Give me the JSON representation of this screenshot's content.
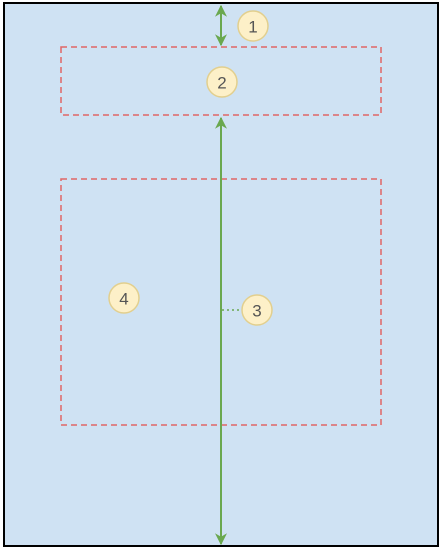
{
  "colors": {
    "background": "#cfe2f3",
    "border": "#000000",
    "dashed_box": "#e06666",
    "arrow": "#6aa84f",
    "badge_fill": "#fdf0c8",
    "badge_stroke": "#e2cf8e",
    "badge_text": "#555555"
  },
  "badges": [
    {
      "label": "1"
    },
    {
      "label": "2"
    },
    {
      "label": "3"
    },
    {
      "label": "4"
    }
  ]
}
